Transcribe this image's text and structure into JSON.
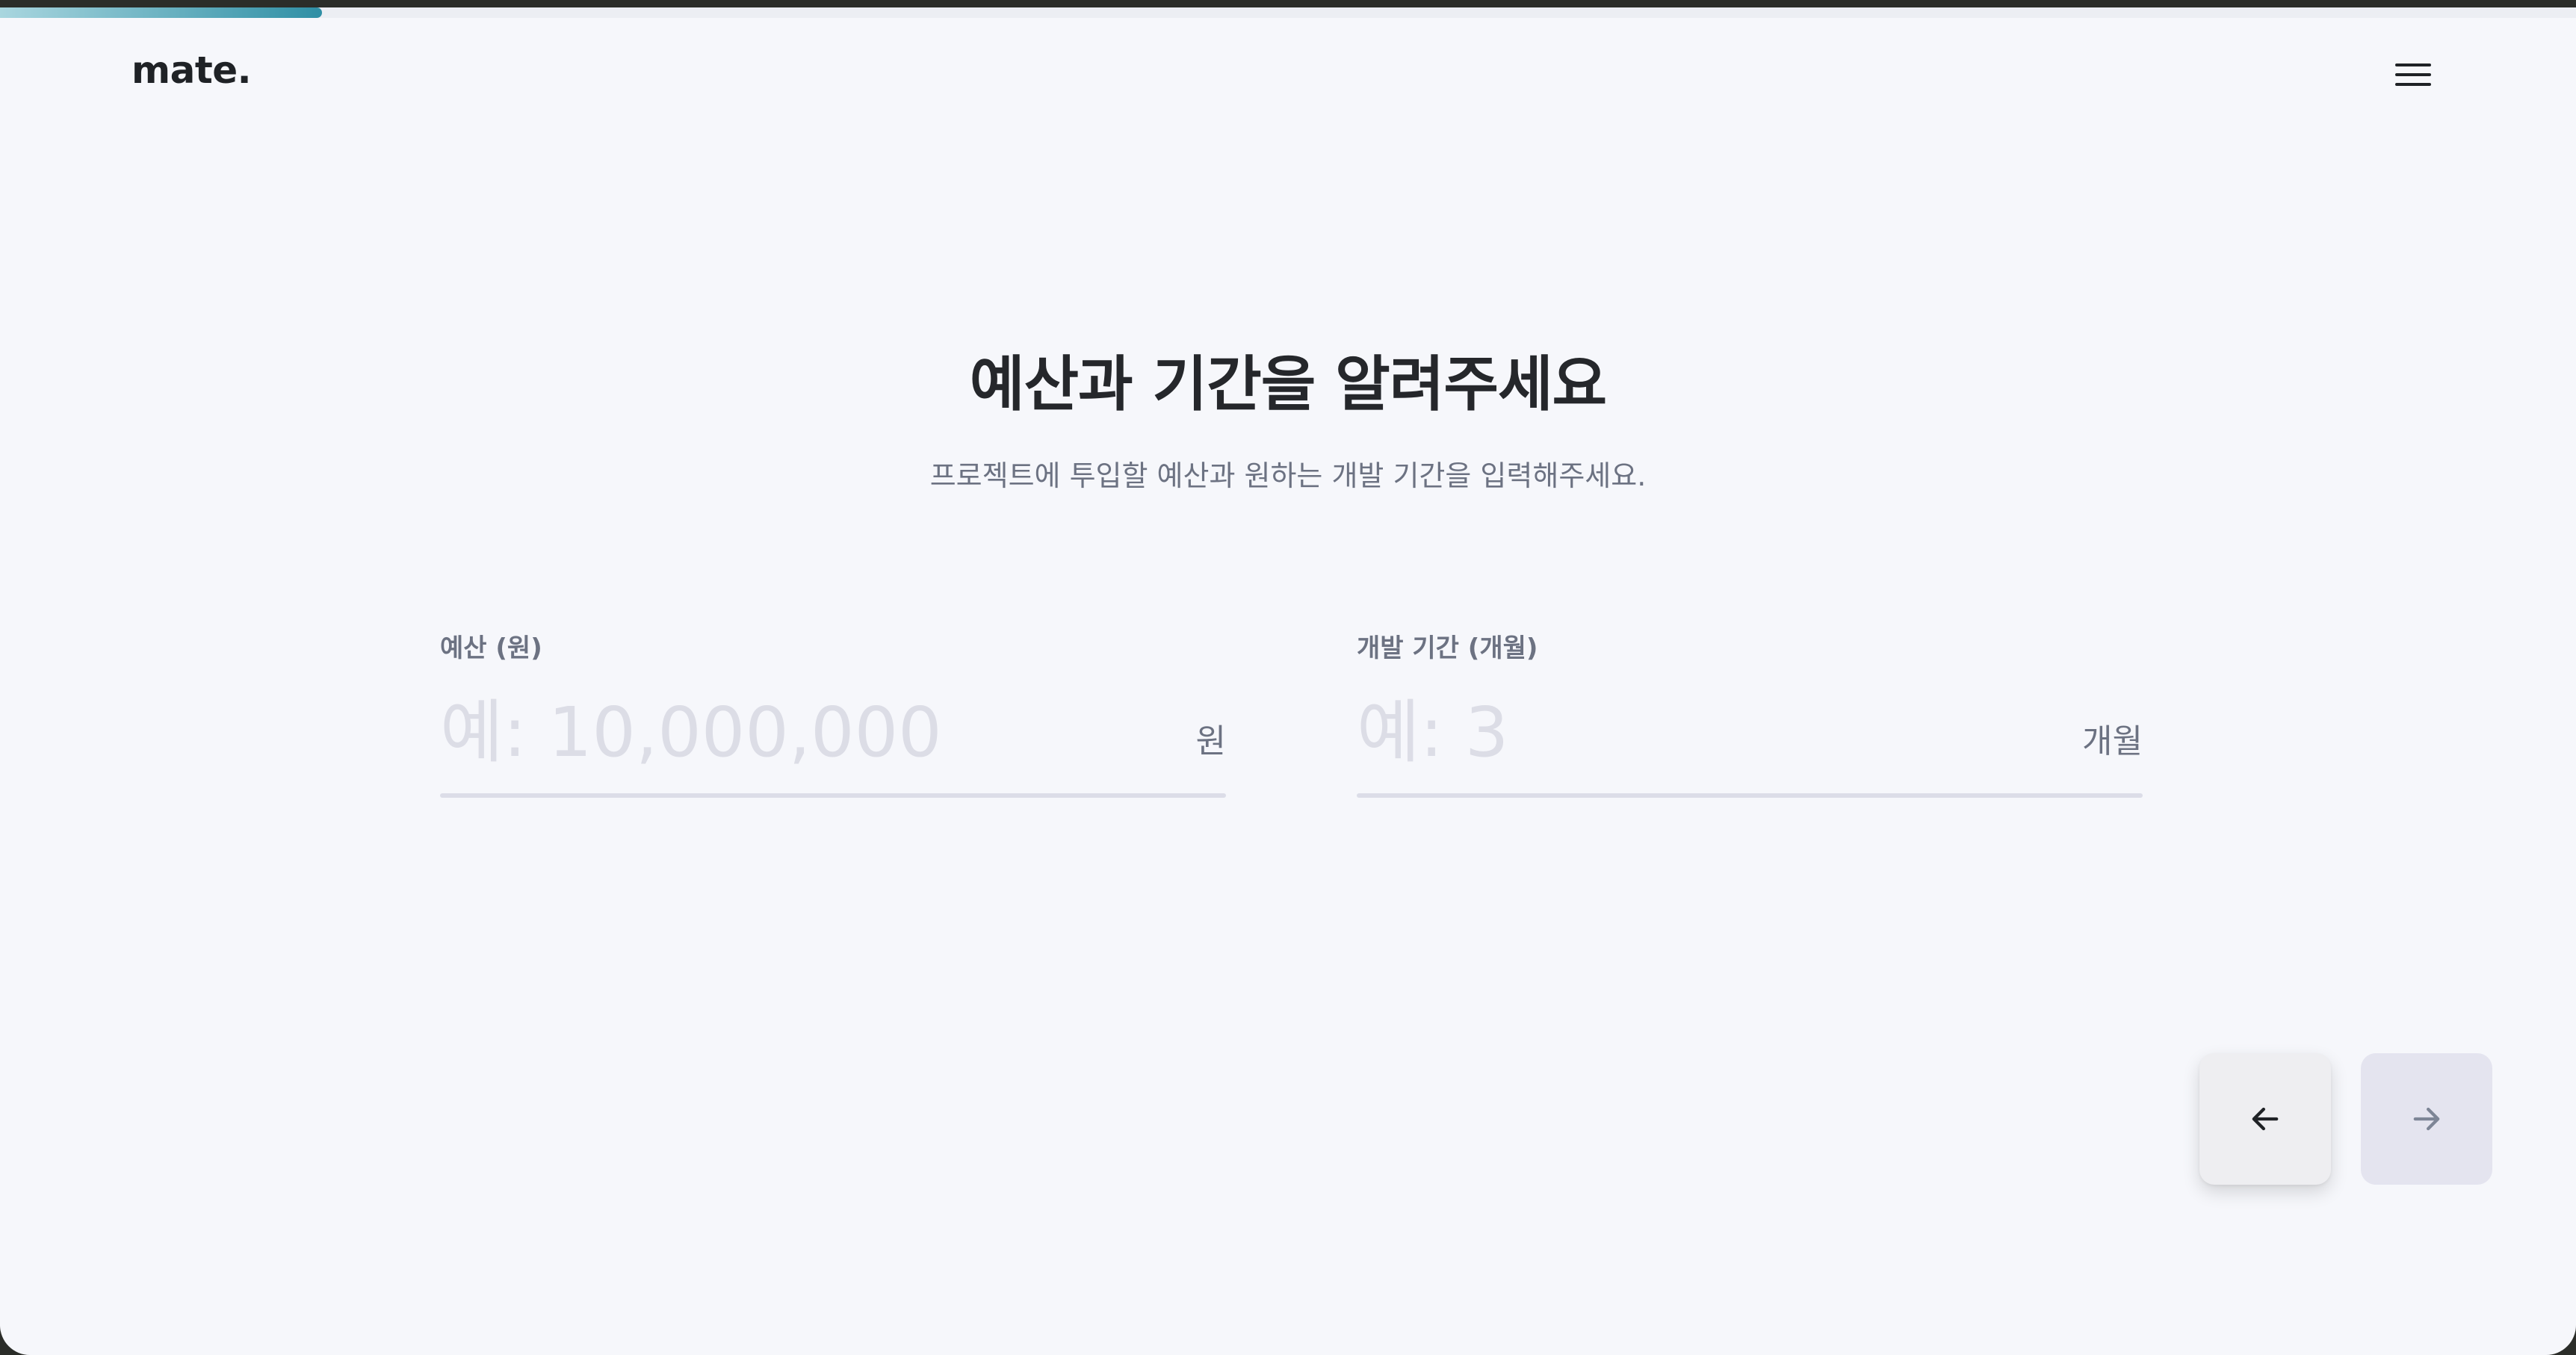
{
  "header": {
    "logo": "mate.",
    "progress": 0.125
  },
  "main": {
    "title": "예산과 기간을 알려주세요",
    "subtitle": "프로젝트에 투입할 예산과 원하는 개발 기간을 입력해주세요."
  },
  "fields": {
    "budget": {
      "label": "예산 (원)",
      "placeholder": "예: 10,000,000",
      "value": "",
      "unit": "원"
    },
    "period": {
      "label": "개발 기간 (개월)",
      "placeholder": "예: 3",
      "value": "",
      "unit": "개월"
    }
  },
  "nav": {
    "back_icon": "arrow-left-icon",
    "next_icon": "arrow-right-icon",
    "back_icon_color": "#1f2226",
    "next_icon_color": "#7d8596"
  }
}
